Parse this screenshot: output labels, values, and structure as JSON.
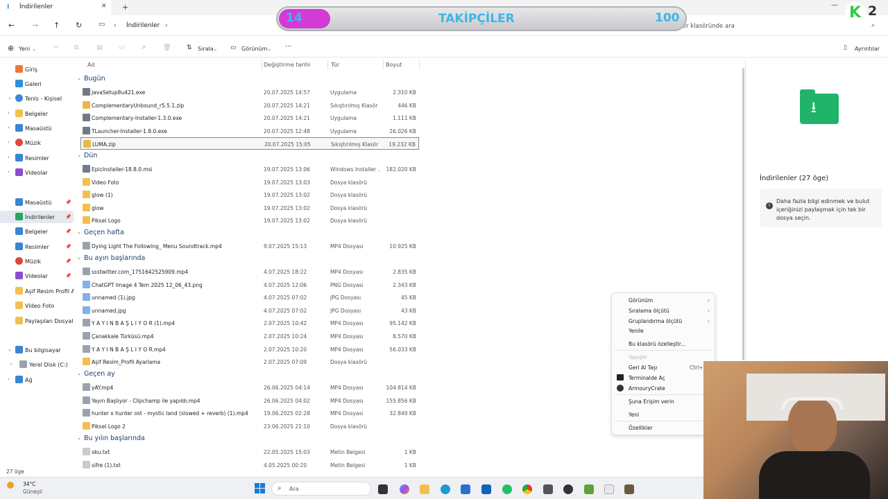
{
  "window": {
    "tab_title": "İndirilenler",
    "new_tab": "+"
  },
  "nav": {
    "location": "İndirilenler",
    "search_placeholder": "İndirilenler klasöründe ara"
  },
  "toolbar": {
    "new_label": "Yeni",
    "sort_label": "Sırala",
    "view_label": "Görünüm",
    "more_label": "···",
    "details_label": "Ayrıntılar"
  },
  "columns": {
    "name": "Ad",
    "modified": "Değiştirme tarihi",
    "type": "Tür",
    "size": "Boyut"
  },
  "sidebar": {
    "top": [
      {
        "label": "Giriş",
        "icon": "home-icon"
      },
      {
        "label": "Galeri",
        "icon": "gallery-icon"
      },
      {
        "label": "Tenis - Kişisel",
        "icon": "cloud-icon"
      },
      {
        "label": "Belgeler",
        "icon": "folder-icon"
      },
      {
        "label": "Masaüstü",
        "icon": "desktop-icon"
      },
      {
        "label": "Müzik",
        "icon": "music-icon"
      },
      {
        "label": "Resimler",
        "icon": "pictures-icon"
      },
      {
        "label": "Videolar",
        "icon": "videos-icon"
      }
    ],
    "pinned": [
      {
        "label": "Masaüstü"
      },
      {
        "label": "İndirilenler"
      },
      {
        "label": "Belgeler"
      },
      {
        "label": "Resimler"
      },
      {
        "label": "Müzik"
      },
      {
        "label": "Videolar"
      },
      {
        "label": "Aşif Resim Profil A"
      },
      {
        "label": "Video Foto"
      },
      {
        "label": "Paylaşılan Dosyalar"
      }
    ],
    "bottom": [
      {
        "label": "Bu bilgisayar"
      },
      {
        "label": "Yerel Disk (C:)"
      },
      {
        "label": "Ağ"
      }
    ]
  },
  "groups": {
    "today": "Bugün",
    "yesterday": "Dün",
    "last_week": "Geçen hafta",
    "this_month": "Bu ayın başlarında",
    "last_month": "Geçen ay",
    "this_year": "Bu yılın başlarında"
  },
  "files": {
    "today": [
      {
        "name": "JavaSetup8u421.exe",
        "date": "20.07.2025 14:57",
        "type": "Uygulama",
        "size": "2.310 KB"
      },
      {
        "name": "ComplementaryUnbound_r5.5.1.zip",
        "date": "20.07.2025 14:21",
        "type": "Sıkıştırılmış Klasör",
        "size": "446 KB"
      },
      {
        "name": "Complementary-Installer-1.3.0.exe",
        "date": "20.07.2025 14:21",
        "type": "Uygulama",
        "size": "1.111 KB"
      },
      {
        "name": "TLauncher-Installer-1.8.0.exe",
        "date": "20.07.2025 12:48",
        "type": "Uygulama",
        "size": "26.026 KB"
      },
      {
        "name": "LUMA.zip",
        "date": "20.07.2025 15:05",
        "type": "Sıkıştırılmış Klasör",
        "size": "19.232 KB"
      }
    ],
    "yesterday": [
      {
        "name": "EpicInstaller-18.8.0.msi",
        "date": "19.07.2025 13:06",
        "type": "Windows Installer ...",
        "size": "182.020 KB"
      },
      {
        "name": "Video Foto",
        "date": "19.07.2025 13:03",
        "type": "Dosya klasörü",
        "size": ""
      },
      {
        "name": "glow (1)",
        "date": "19.07.2025 13:02",
        "type": "Dosya klasörü",
        "size": ""
      },
      {
        "name": "glow",
        "date": "19.07.2025 13:02",
        "type": "Dosya klasörü",
        "size": ""
      },
      {
        "name": "Piksel Logo",
        "date": "19.07.2025 13:02",
        "type": "Dosya klasörü",
        "size": ""
      }
    ],
    "last_week": [
      {
        "name": "Dying Light The Following_ Menu Soundtrack.mp4",
        "date": "9.07.2025 15:13",
        "type": "MP4 Dosyası",
        "size": "10.925 KB"
      }
    ],
    "this_month": [
      {
        "name": "ssstwitter.com_1751642525909.mp4",
        "date": "4.07.2025 18:22",
        "type": "MP4 Dosyası",
        "size": "2.835 KB"
      },
      {
        "name": "ChatGPT Image 4 Tem 2025 12_06_43.png",
        "date": "4.07.2025 12:06",
        "type": "PNG Dosyası",
        "size": "2.343 KB"
      },
      {
        "name": "unnamed (1).jpg",
        "date": "4.07.2025 07:02",
        "type": "JPG Dosyası",
        "size": "45 KB"
      },
      {
        "name": "unnamed.jpg",
        "date": "4.07.2025 07:02",
        "type": "JPG Dosyası",
        "size": "43 KB"
      },
      {
        "name": "Y A Y I N B A Ş L I Y O R (1).mp4",
        "date": "2.07.2025 10:42",
        "type": "MP4 Dosyası",
        "size": "95.142 KB"
      },
      {
        "name": "Çanakkale Türküsü.mp4",
        "date": "2.07.2025 10:24",
        "type": "MP4 Dosyası",
        "size": "8.570 KB"
      },
      {
        "name": "Y A Y I N B A Ş L I Y O R.mp4",
        "date": "2.07.2025 10:20",
        "type": "MP4 Dosyası",
        "size": "56.033 KB"
      },
      {
        "name": "Aşif Resim_Profil Ayarlama",
        "date": "2.07.2025 07:09",
        "type": "Dosya klasörü",
        "size": ""
      }
    ],
    "last_month": [
      {
        "name": "yAY.mp4",
        "date": "26.06.2025 04:14",
        "type": "MP4 Dosyası",
        "size": "104.814 KB"
      },
      {
        "name": "Yayın Başlıyor - Clipchamp ile yapıldı.mp4",
        "date": "26.06.2025 04:02",
        "type": "MP4 Dosyası",
        "size": "155.856 KB"
      },
      {
        "name": "hunter x hunter ost - mystic land (slowed + reverb) (1).mp4",
        "date": "19.06.2025 02:28",
        "type": "MP4 Dosyası",
        "size": "32.849 KB"
      },
      {
        "name": "Piksel Logo 2",
        "date": "23.06.2025 21:10",
        "type": "Dosya klasörü",
        "size": ""
      }
    ],
    "this_year": [
      {
        "name": "oku.txt",
        "date": "22.05.2025 15:03",
        "type": "Metin Belgesi",
        "size": "1 KB"
      },
      {
        "name": "sifre (1).txt",
        "date": "4.05.2025 00:20",
        "type": "Metin Belgesi",
        "size": "1 KB"
      }
    ]
  },
  "details_pane": {
    "title": "İndirilenler (27 öge)",
    "info": "Daha fazla bilgi edinmek ve bulut içeriğinizi paylaşmak için tek bir dosya seçin."
  },
  "context_menu": {
    "items": [
      {
        "label": "Görünüm",
        "submenu": true
      },
      {
        "label": "Sıralama ölçütü",
        "submenu": true
      },
      {
        "label": "Gruplandırma ölçütü",
        "submenu": true
      },
      {
        "label": "Yenile"
      },
      {
        "label": "Bu klasörü özelleştir..."
      },
      {
        "label": "Yapıştır",
        "disabled": true
      },
      {
        "label": "Geri Al Taşı",
        "shortcut": "Ctrl+Z"
      },
      {
        "label": "Terminalde Aç"
      },
      {
        "label": "ArmouryCrate"
      },
      {
        "label": "Şuna Erişim verin",
        "submenu": true
      },
      {
        "label": "Yeni",
        "submenu": true
      },
      {
        "label": "Özellikler"
      }
    ]
  },
  "status": {
    "item_count": "27 öge"
  },
  "taskbar": {
    "weather_temp": "34°C",
    "weather_desc": "Güneşli",
    "search_label": "Ara"
  },
  "overlay": {
    "left_count": "14",
    "title": "TAKİPÇİLER",
    "right_count": "100",
    "corner": "2"
  },
  "colors": {
    "accent": "#0067c0",
    "folder": "#f3c04f",
    "banner_text": "#3db6e8",
    "banner_pill": "#d23bd6"
  }
}
